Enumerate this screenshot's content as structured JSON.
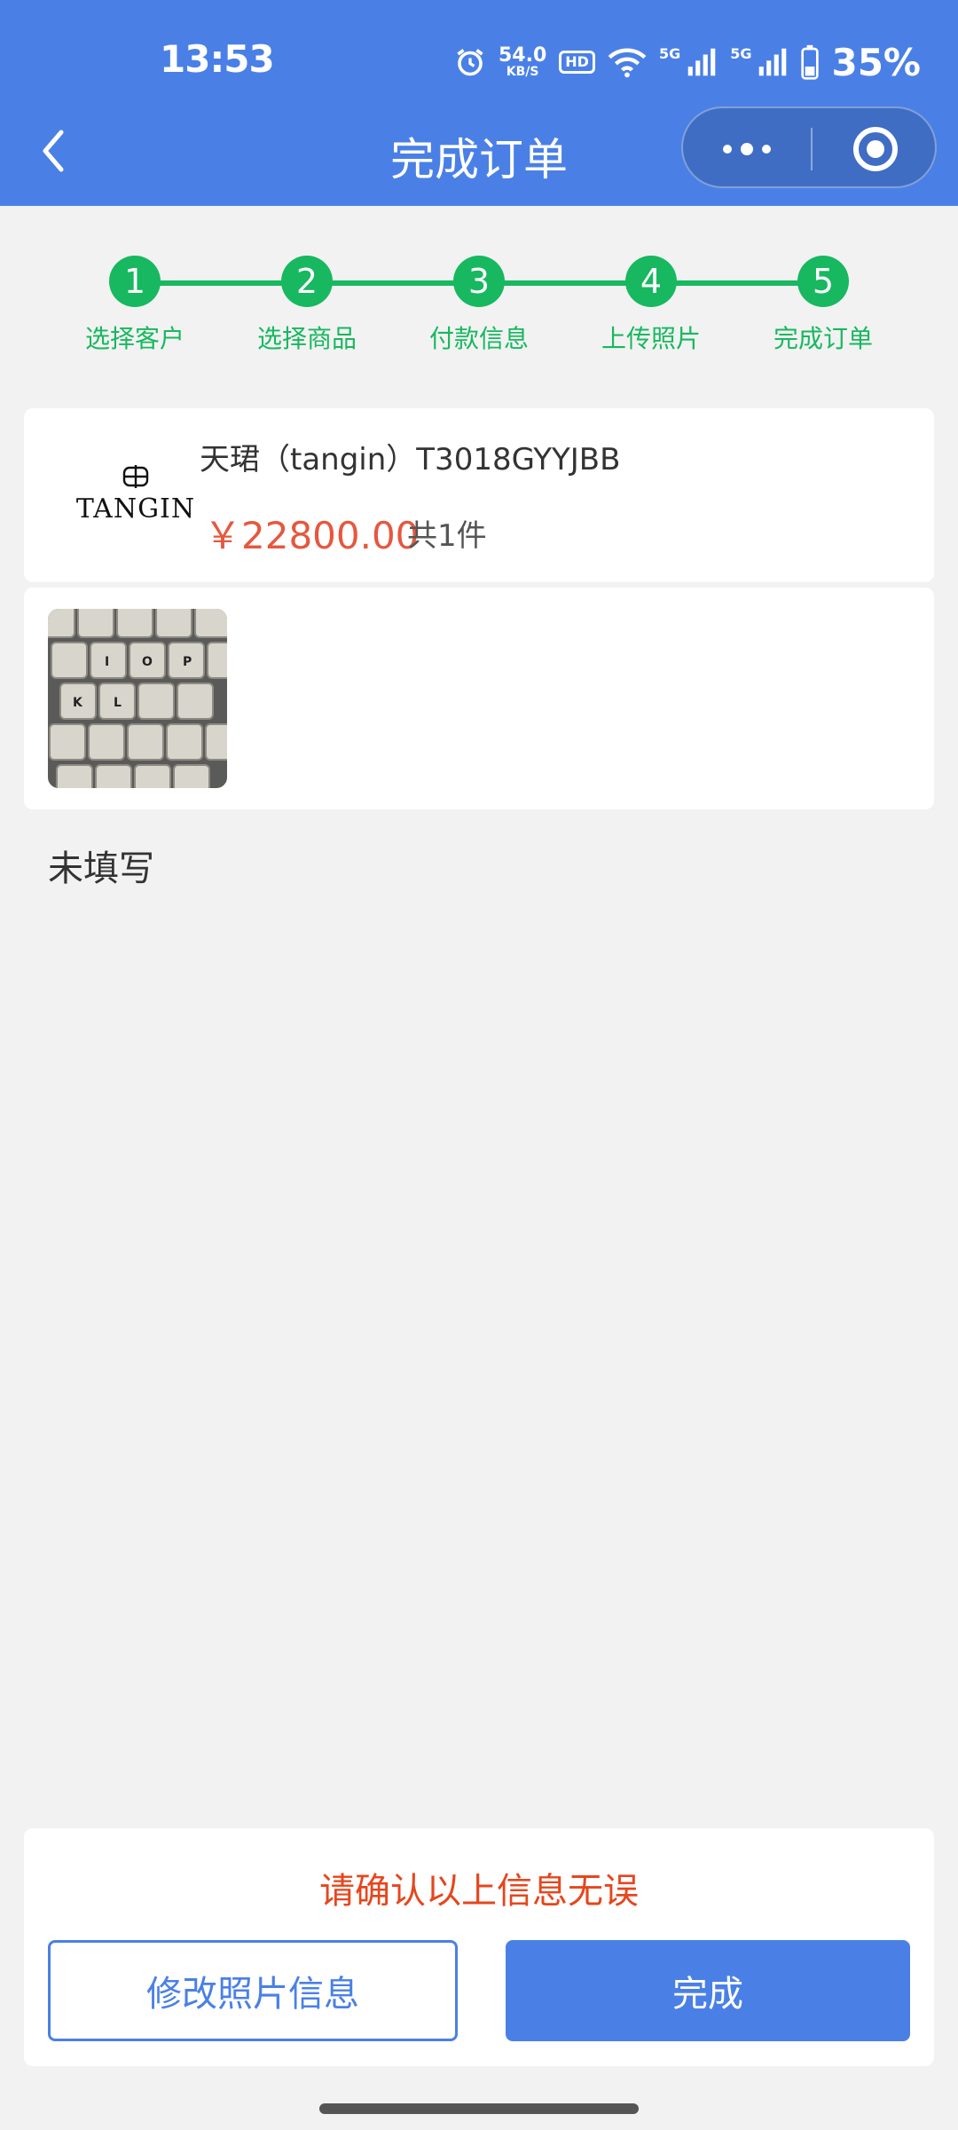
{
  "status_bar": {
    "time": "13:53",
    "net_speed_value": "54.0",
    "net_speed_unit": "KB/S",
    "hd_label": "HD",
    "sig1_label": "5G",
    "sig2_label": "5G",
    "battery": "35%"
  },
  "nav": {
    "title": "完成订单"
  },
  "steps": [
    {
      "num": "1",
      "label": "选择客户"
    },
    {
      "num": "2",
      "label": "选择商品"
    },
    {
      "num": "3",
      "label": "付款信息"
    },
    {
      "num": "4",
      "label": "上传照片"
    },
    {
      "num": "5",
      "label": "完成订单"
    }
  ],
  "product": {
    "brand": "TANGIN",
    "title": "天珺（tangin）T3018GYYJBB",
    "price": "￥22800.00",
    "qty": "共1件"
  },
  "remark": "未填写",
  "bottom": {
    "confirm_text": "请确认以上信息无误",
    "edit_label": "修改照片信息",
    "done_label": "完成"
  },
  "colors": {
    "primary": "#4a80e6",
    "step_green": "#17b85f",
    "price": "#e5583e",
    "warning": "#e6461d"
  }
}
